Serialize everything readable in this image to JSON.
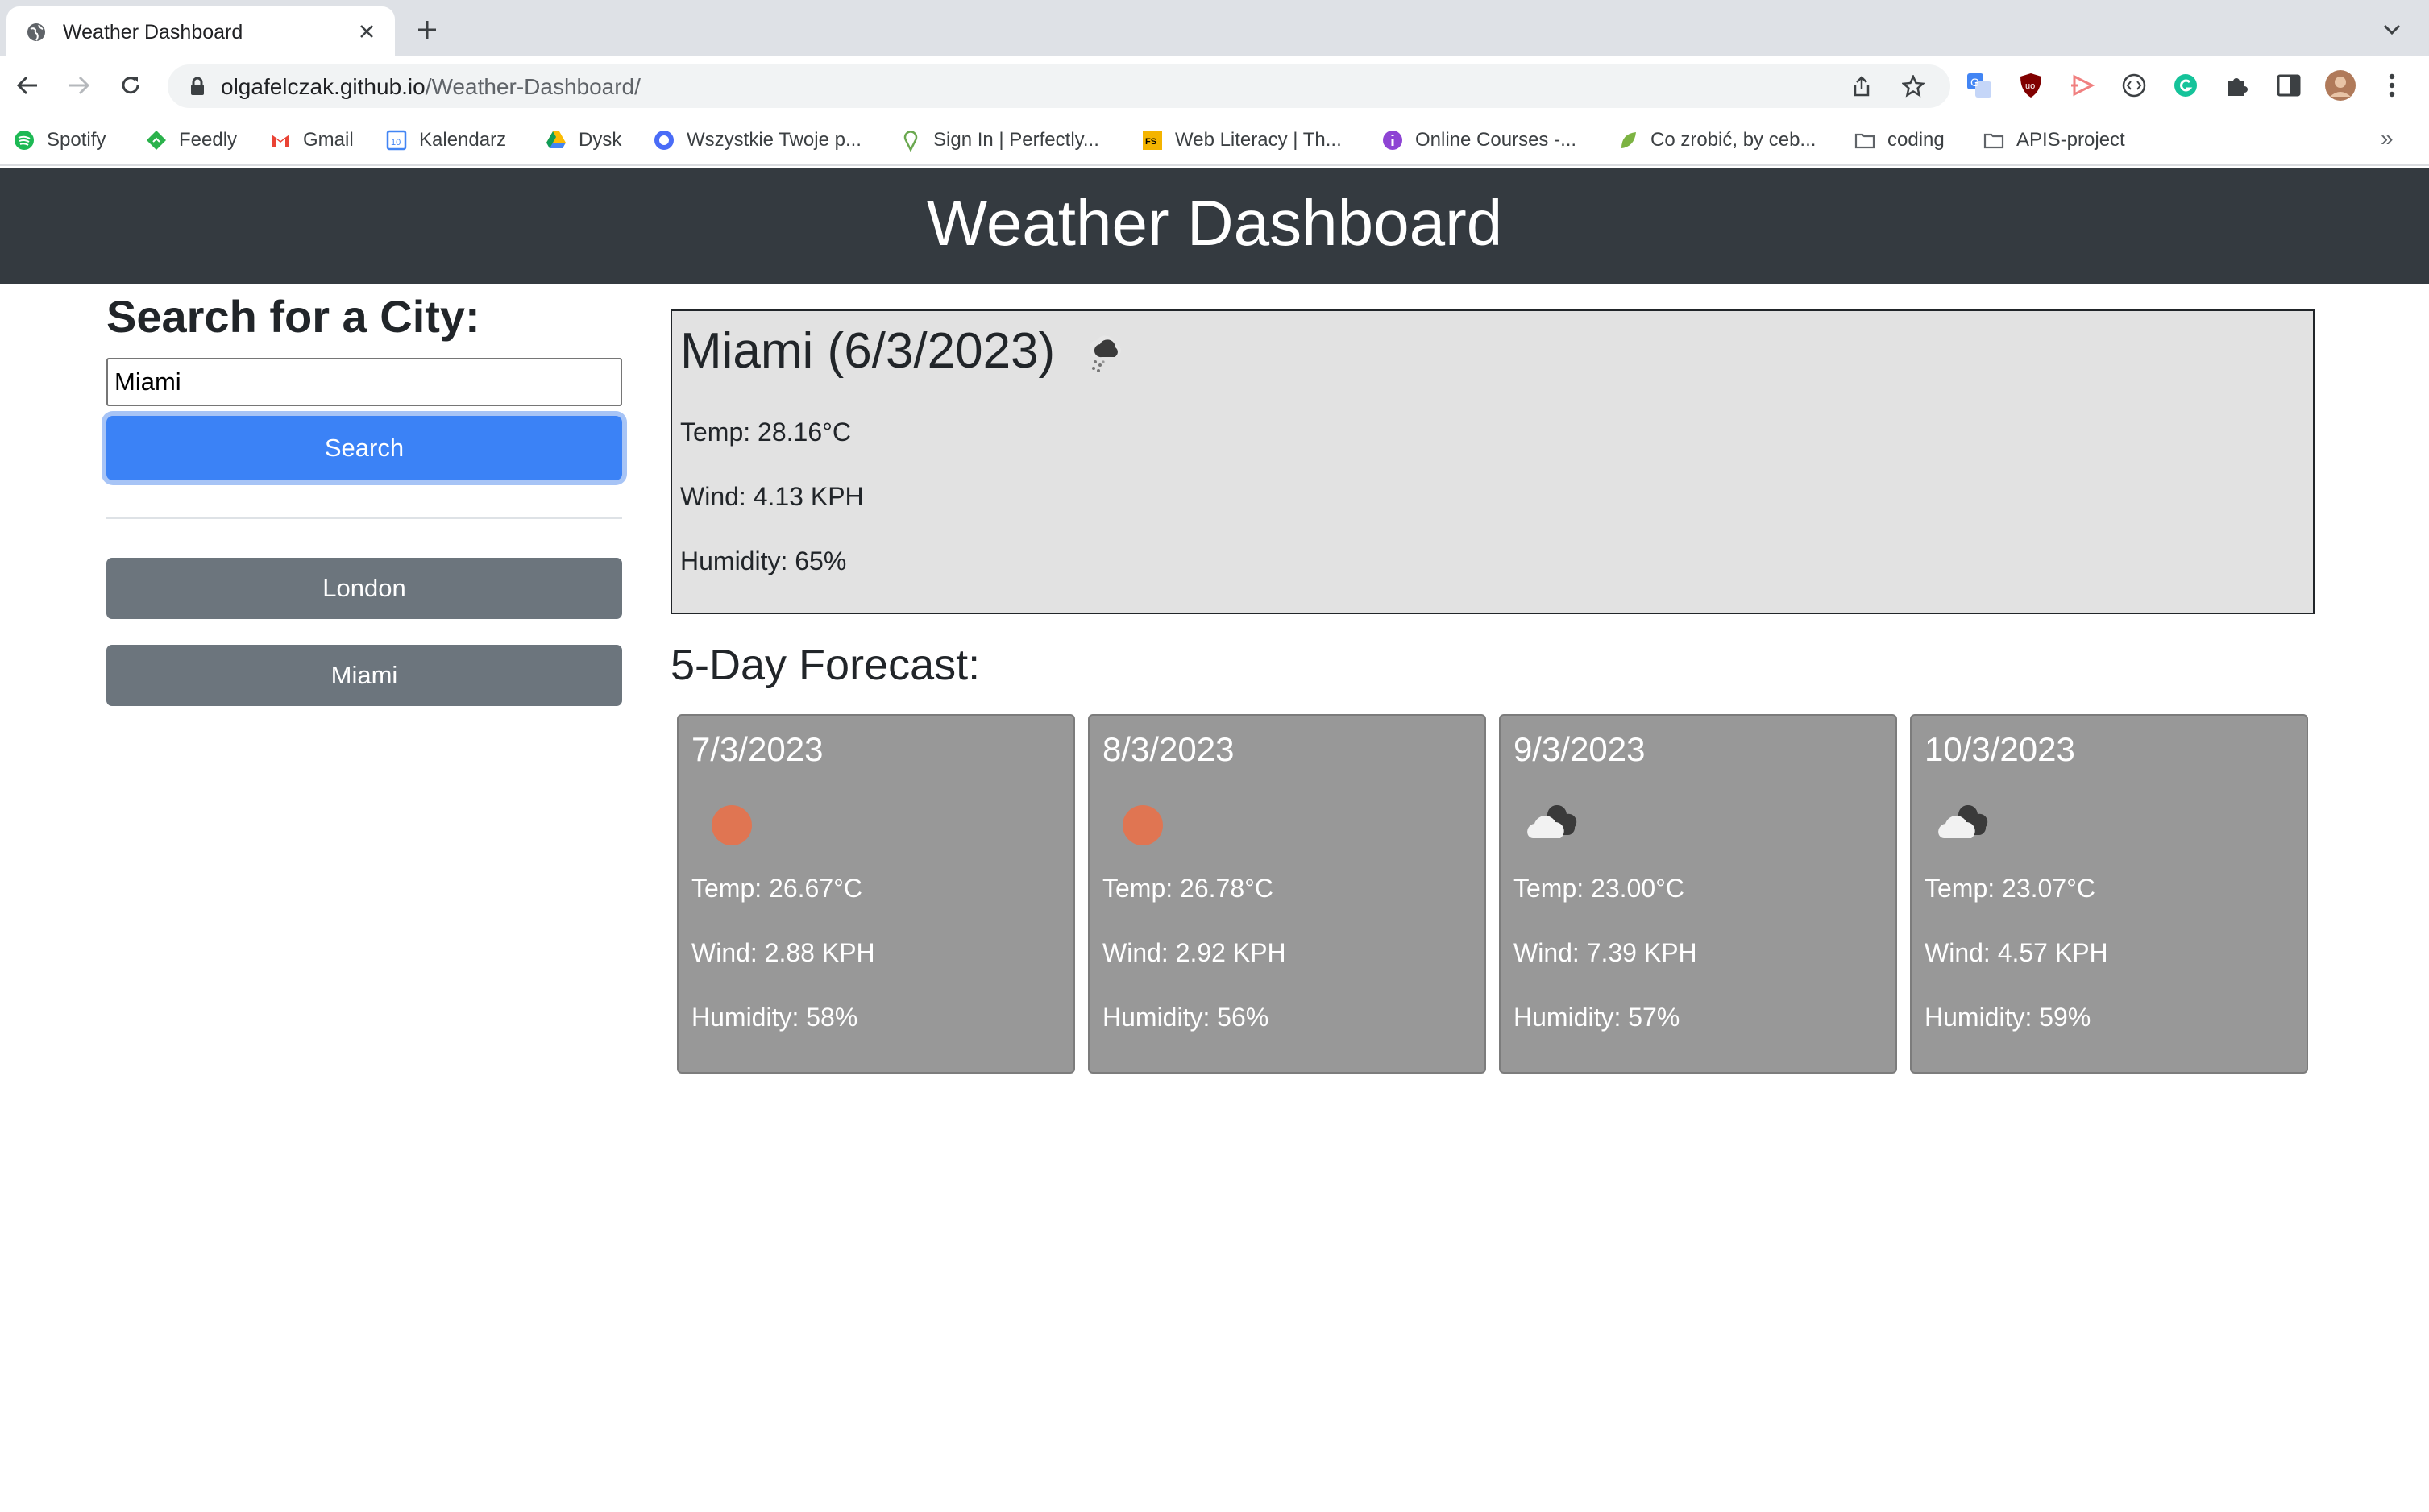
{
  "browser": {
    "tab": {
      "title": "Weather Dashboard",
      "favicon": "globe-icon"
    },
    "url": {
      "host": "olgafelczak.github.io",
      "path": "/Weather-Dashboard/"
    },
    "bookmarks": [
      {
        "label": "Spotify",
        "icon": "spotify-icon",
        "color": "#1db954"
      },
      {
        "label": "Feedly",
        "icon": "feedly-icon",
        "color": "#2bb24c"
      },
      {
        "label": "Gmail",
        "icon": "gmail-icon",
        "color": "#ea4335"
      },
      {
        "label": "Kalendarz",
        "icon": "calendar-icon",
        "color": "#4285f4"
      },
      {
        "label": "Dysk",
        "icon": "drive-icon",
        "color": "#fbbc04"
      },
      {
        "label": "Wszystkie Twoje p...",
        "icon": "site-icon",
        "color": "#4a6cf7"
      },
      {
        "label": "Sign In | Perfectly...",
        "icon": "pin-icon",
        "color": "#6aa84f"
      },
      {
        "label": "Web Literacy | Th...",
        "icon": "fs-icon",
        "color": "#f4b400"
      },
      {
        "label": "Online Courses -...",
        "icon": "info-icon",
        "color": "#8e44d4"
      },
      {
        "label": "Co zrobić, by ceb...",
        "icon": "leaf-icon",
        "color": "#7cb342"
      },
      {
        "label": "coding",
        "icon": "folder-icon",
        "color": "#5f6368"
      },
      {
        "label": "APIS-project",
        "icon": "folder-icon",
        "color": "#5f6368"
      }
    ]
  },
  "header": {
    "title": "Weather Dashboard"
  },
  "search": {
    "title": "Search for a City:",
    "input_value": "Miami",
    "button_label": "Search",
    "history": [
      "London",
      "Miami"
    ]
  },
  "current": {
    "title": "Miami (6/3/2023)",
    "icon": "snow-cloud-icon",
    "temp": "Temp: 28.16°C",
    "wind": "Wind: 4.13 KPH",
    "humidity": "Humidity: 65%"
  },
  "forecast": {
    "title": "5-Day Forecast:",
    "days": [
      {
        "date": "7/3/2023",
        "icon": "sun-icon",
        "temp": "Temp: 26.67°C",
        "wind": "Wind: 2.88 KPH",
        "humidity": "Humidity: 58%"
      },
      {
        "date": "8/3/2023",
        "icon": "sun-icon",
        "temp": "Temp: 26.78°C",
        "wind": "Wind: 2.92 KPH",
        "humidity": "Humidity: 56%"
      },
      {
        "date": "9/3/2023",
        "icon": "broken-clouds-icon",
        "temp": "Temp: 23.00°C",
        "wind": "Wind: 7.39 KPH",
        "humidity": "Humidity: 57%"
      },
      {
        "date": "10/3/2023",
        "icon": "broken-clouds-icon",
        "temp": "Temp: 23.07°C",
        "wind": "Wind: 4.57 KPH",
        "humidity": "Humidity: 59%"
      }
    ]
  },
  "colors": {
    "header_bg": "#343a40",
    "primary": "#3b82f6",
    "secondary": "#6c757d",
    "current_bg": "#e2e2e2",
    "card_bg": "#989898",
    "sun": "#e07552"
  }
}
